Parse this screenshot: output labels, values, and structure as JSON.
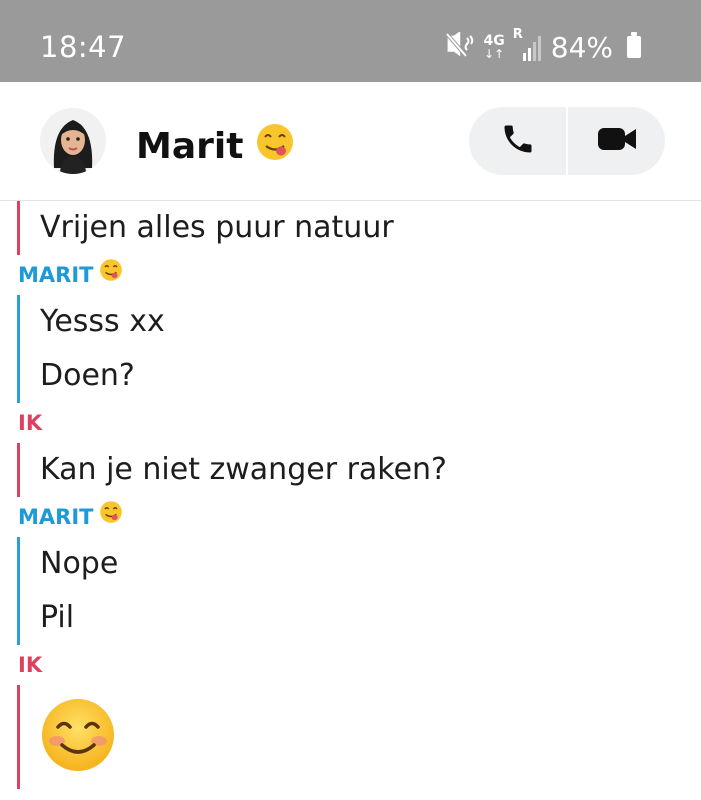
{
  "status_bar": {
    "time": "18:47",
    "network": "4G",
    "roaming": "R",
    "battery": "84%",
    "icons": [
      "vibrate-mute-icon",
      "network-4g-icon",
      "signal-bars-icon",
      "battery-icon"
    ]
  },
  "header": {
    "contact_name": "Marit",
    "name_emoji": "face-savoring-food-emoji",
    "call_icon": "phone-icon",
    "video_icon": "video-camera-icon"
  },
  "sender_labels": {
    "me": "IK",
    "other": "MARIT"
  },
  "messages": [
    {
      "sender": "me",
      "text": "Vrijen alles puur natuur"
    },
    {
      "sender": "other",
      "text": "Yesss xx"
    },
    {
      "sender": "other",
      "text": "Doen?"
    },
    {
      "sender": "me",
      "text": "Kan je niet zwanger raken?"
    },
    {
      "sender": "other",
      "text": "Nope"
    },
    {
      "sender": "other",
      "text": "Pil"
    },
    {
      "sender": "me",
      "emoji": "smiling-face-with-smiling-eyes"
    }
  ],
  "colors": {
    "me": "#e0405f",
    "other": "#2d9fd8",
    "status_bar": "#9a9a9a",
    "call_bg": "#eef0f2"
  }
}
